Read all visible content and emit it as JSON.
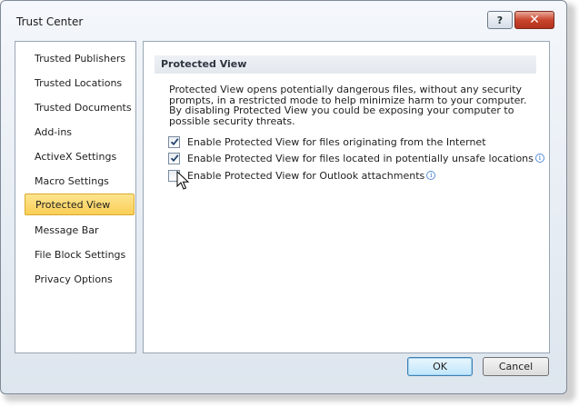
{
  "window": {
    "title": "Trust Center",
    "help_icon": "?",
    "close_icon": "✕"
  },
  "sidebar": {
    "items": [
      {
        "label": "Trusted Publishers"
      },
      {
        "label": "Trusted Locations"
      },
      {
        "label": "Trusted Documents"
      },
      {
        "label": "Add-ins"
      },
      {
        "label": "ActiveX Settings"
      },
      {
        "label": "Macro Settings"
      },
      {
        "label": "Protected View",
        "selected": true
      },
      {
        "label": "Message Bar"
      },
      {
        "label": "File Block Settings"
      },
      {
        "label": "Privacy Options"
      }
    ]
  },
  "main": {
    "section_title": "Protected View",
    "description": "Protected View opens potentially dangerous files, without any security prompts, in a restricted mode to help minimize harm to your computer. By disabling Protected View you could be exposing your computer to possible security threats.",
    "options": [
      {
        "label": "Enable Protected View for files originating from the Internet",
        "checked": true,
        "info": false
      },
      {
        "label": "Enable Protected View for files located in potentially unsafe locations",
        "checked": true,
        "info": true
      },
      {
        "label": "Enable Protected View for Outlook attachments",
        "checked": false,
        "info": true
      }
    ]
  },
  "footer": {
    "ok_label": "OK",
    "cancel_label": "Cancel"
  },
  "colors": {
    "selected_item": "#fbd76b",
    "close_button": "#c9452d"
  }
}
